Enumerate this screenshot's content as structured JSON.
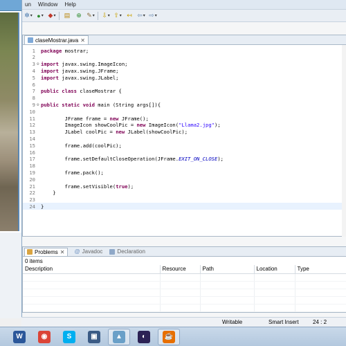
{
  "menu": {
    "items": [
      "un",
      "Window",
      "Help"
    ]
  },
  "editor": {
    "tab_title": "claseMostrar.java",
    "tab_close": "✕",
    "lines": [
      {
        "n": "1",
        "code": [
          {
            "t": "package",
            "c": "kw"
          },
          {
            "t": " mostrar;",
            "c": ""
          }
        ]
      },
      {
        "n": "2",
        "code": []
      },
      {
        "n": "3",
        "fold": "⊖",
        "code": [
          {
            "t": "import",
            "c": "kw"
          },
          {
            "t": " javax.swing.ImageIcon;",
            "c": ""
          }
        ]
      },
      {
        "n": "4",
        "code": [
          {
            "t": "import",
            "c": "kw"
          },
          {
            "t": " javax.swing.JFrame;",
            "c": ""
          }
        ]
      },
      {
        "n": "5",
        "code": [
          {
            "t": "import",
            "c": "kw"
          },
          {
            "t": " javax.swing.JLabel;",
            "c": ""
          }
        ]
      },
      {
        "n": "6",
        "code": []
      },
      {
        "n": "7",
        "code": [
          {
            "t": "public class",
            "c": "kw"
          },
          {
            "t": " claseMostrar {",
            "c": ""
          }
        ]
      },
      {
        "n": "8",
        "code": []
      },
      {
        "n": "9",
        "fold": "⊖",
        "code": [
          {
            "t": "public static void",
            "c": "kw"
          },
          {
            "t": " main (String args[]){",
            "c": ""
          }
        ]
      },
      {
        "n": "10",
        "code": []
      },
      {
        "n": "11",
        "code": [
          {
            "t": "        JFrame frame = ",
            "c": ""
          },
          {
            "t": "new",
            "c": "kw"
          },
          {
            "t": " JFrame();",
            "c": ""
          }
        ]
      },
      {
        "n": "12",
        "code": [
          {
            "t": "        ImageIcon showCoolPic = ",
            "c": ""
          },
          {
            "t": "new",
            "c": "kw"
          },
          {
            "t": " ImageIcon(",
            "c": ""
          },
          {
            "t": "\"Llama2.jpg\"",
            "c": "str"
          },
          {
            "t": ");",
            "c": ""
          }
        ]
      },
      {
        "n": "13",
        "code": [
          {
            "t": "        JLabel coolPic = ",
            "c": ""
          },
          {
            "t": "new",
            "c": "kw"
          },
          {
            "t": " JLabel(showCoolPic);",
            "c": ""
          }
        ]
      },
      {
        "n": "14",
        "code": []
      },
      {
        "n": "15",
        "code": [
          {
            "t": "        frame.add(coolPic);",
            "c": ""
          }
        ]
      },
      {
        "n": "16",
        "code": []
      },
      {
        "n": "17",
        "code": [
          {
            "t": "        frame.setDefaultCloseOperation(JFrame.",
            "c": ""
          },
          {
            "t": "EXIT_ON_CLOSE",
            "c": "fld"
          },
          {
            "t": ");",
            "c": ""
          }
        ]
      },
      {
        "n": "18",
        "code": []
      },
      {
        "n": "19",
        "code": [
          {
            "t": "        frame.pack();",
            "c": ""
          }
        ]
      },
      {
        "n": "20",
        "code": []
      },
      {
        "n": "21",
        "code": [
          {
            "t": "        frame.setVisible(",
            "c": ""
          },
          {
            "t": "true",
            "c": "kw"
          },
          {
            "t": ");",
            "c": ""
          }
        ]
      },
      {
        "n": "22",
        "code": [
          {
            "t": "    }",
            "c": ""
          }
        ]
      },
      {
        "n": "23",
        "code": []
      },
      {
        "n": "24",
        "cur": true,
        "code": [
          {
            "t": "}",
            "c": ""
          }
        ]
      }
    ]
  },
  "panel": {
    "tabs": [
      {
        "label": "Problems",
        "active": true,
        "close": "✕"
      },
      {
        "label": "Javadoc",
        "active": false
      },
      {
        "label": "Declaration",
        "active": false
      }
    ],
    "count": "0 items",
    "columns": [
      "Description",
      "Resource",
      "Path",
      "Location",
      "Type"
    ]
  },
  "status": {
    "writable": "Writable",
    "insert_mode": "Smart Insert",
    "position": "24 : 2"
  },
  "taskbar": {
    "apps": [
      {
        "name": "word-icon",
        "glyph": "W",
        "color": "#2b579a",
        "active": false
      },
      {
        "name": "chrome-icon",
        "glyph": "◉",
        "color": "#db4437",
        "active": false
      },
      {
        "name": "skype-icon",
        "glyph": "S",
        "color": "#00aff0",
        "active": false
      },
      {
        "name": "save-disk-icon",
        "glyph": "▣",
        "color": "#3b5b85",
        "active": false
      },
      {
        "name": "image-viewer-icon",
        "glyph": "▲",
        "color": "#6aa0c8",
        "active": true
      },
      {
        "name": "eclipse-icon",
        "glyph": "◐",
        "color": "#2c2255",
        "active": false
      },
      {
        "name": "java-icon",
        "glyph": "☕",
        "color": "#e76f00",
        "active": true
      }
    ]
  }
}
